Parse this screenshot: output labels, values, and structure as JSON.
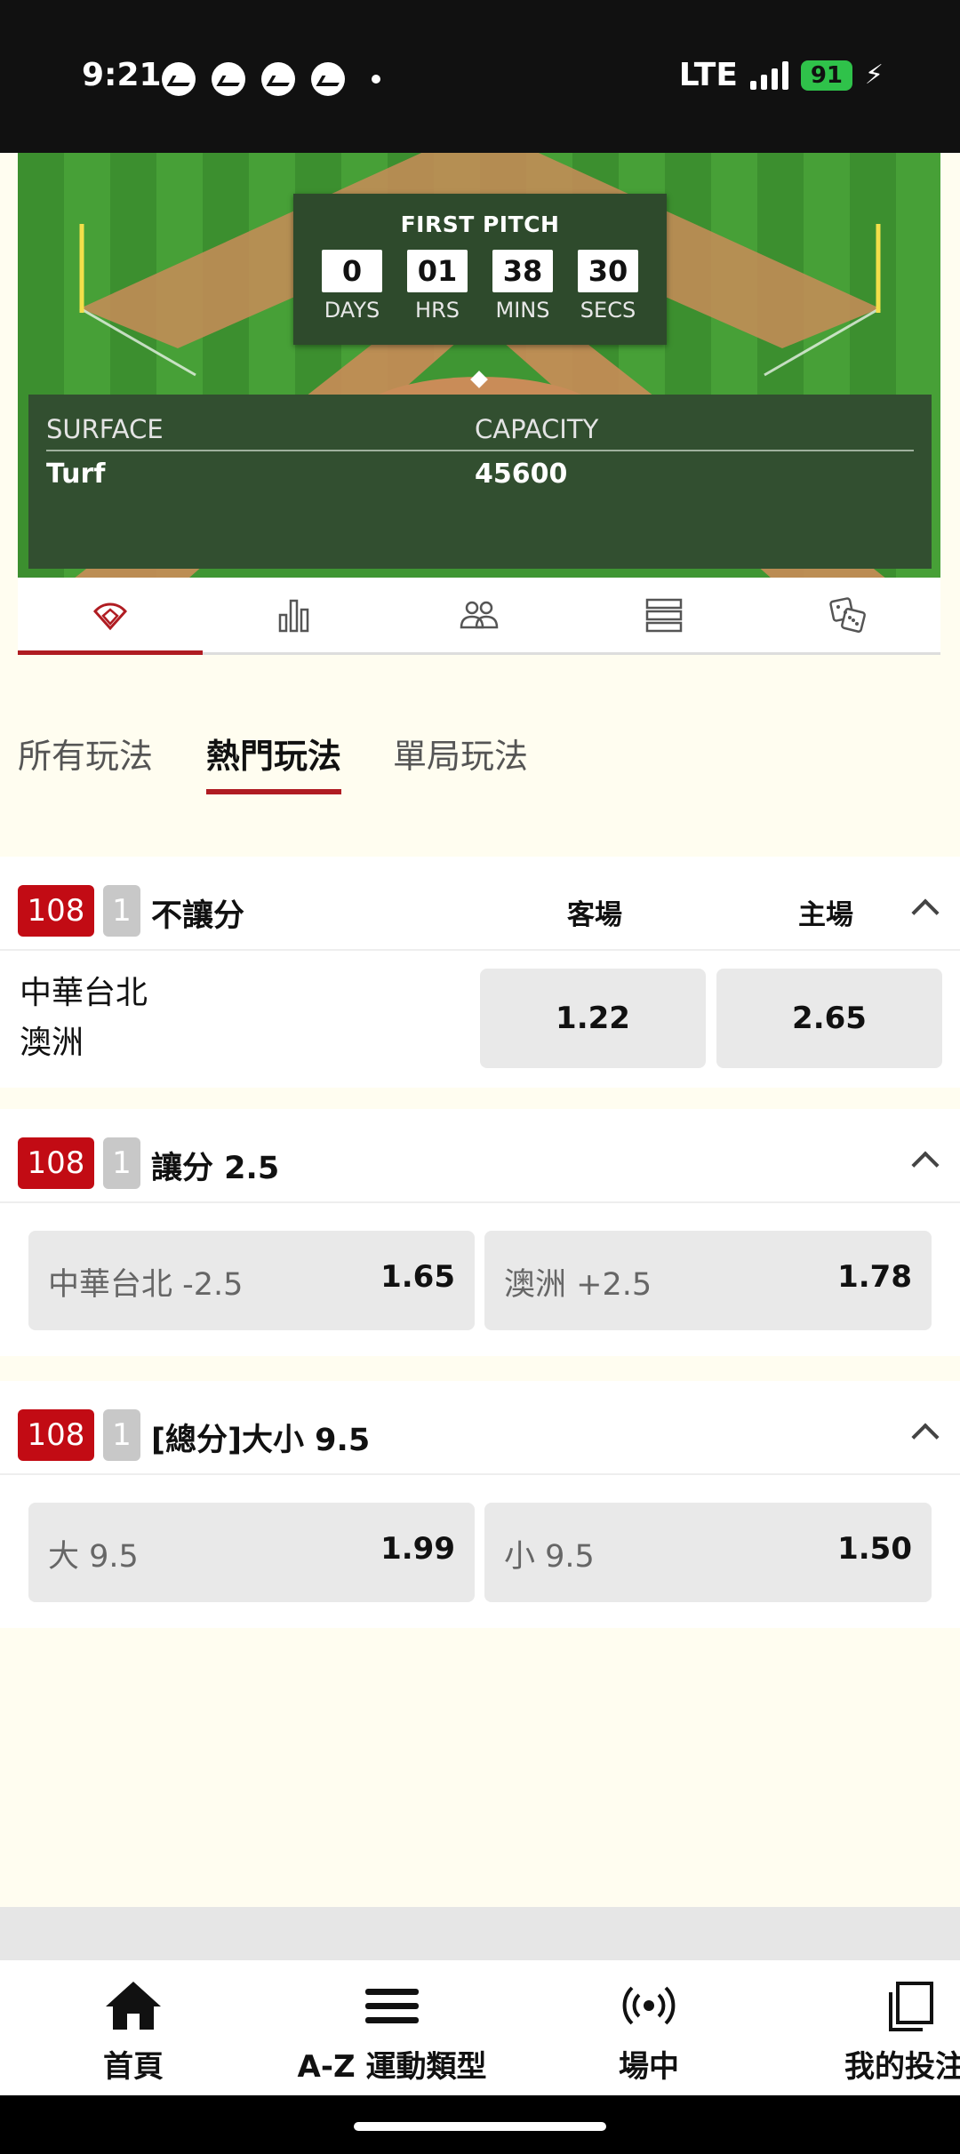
{
  "status_bar": {
    "time": "9:21",
    "network": "LTE",
    "battery": "91",
    "notification_icons": [
      "messenger-icon",
      "messenger-icon",
      "messenger-icon",
      "messenger-icon"
    ]
  },
  "countdown": {
    "title": "FIRST PITCH",
    "days": "0",
    "days_label": "DAYS",
    "hours": "01",
    "hours_label": "HRS",
    "mins": "38",
    "mins_label": "MINS",
    "secs": "30",
    "secs_label": "SECS"
  },
  "venue": {
    "surface_label": "SURFACE",
    "surface_value": "Turf",
    "capacity_label": "CAPACITY",
    "capacity_value": "45600"
  },
  "icon_tabs": [
    "baseball-field-icon",
    "bar-chart-icon",
    "players-icon",
    "list-icon",
    "dice-icon"
  ],
  "bet_tabs": [
    "所有玩法",
    "熱門玩法",
    "單局玩法"
  ],
  "active_bet_tab": "熱門玩法",
  "markets": {
    "moneyline": {
      "badge_id": "108",
      "badge_num": "1",
      "title": "不讓分",
      "away_label": "客場",
      "home_label": "主場",
      "team_a": "中華台北",
      "team_b": "澳洲",
      "away_odds": "1.22",
      "home_odds": "2.65"
    },
    "handicap": {
      "badge_id": "108",
      "badge_num": "1",
      "title": "讓分 2.5",
      "opt1_label": "中華台北 -2.5",
      "opt1_odds": "1.65",
      "opt2_label": "澳洲 +2.5",
      "opt2_odds": "1.78"
    },
    "total": {
      "badge_id": "108",
      "badge_num": "1",
      "title": "[總分]大小 9.5",
      "opt1_label": "大 9.5",
      "opt1_odds": "1.99",
      "opt2_label": "小 9.5",
      "opt2_odds": "1.50"
    }
  },
  "bottom_nav": {
    "home": "首頁",
    "az": "A-Z 運動類型",
    "live": "場中",
    "mybets": "我的投注"
  },
  "colors": {
    "accent": "#b01c22",
    "badge_red": "#c20b14",
    "field_green": "#47a037",
    "panel_green": "#324f30"
  }
}
